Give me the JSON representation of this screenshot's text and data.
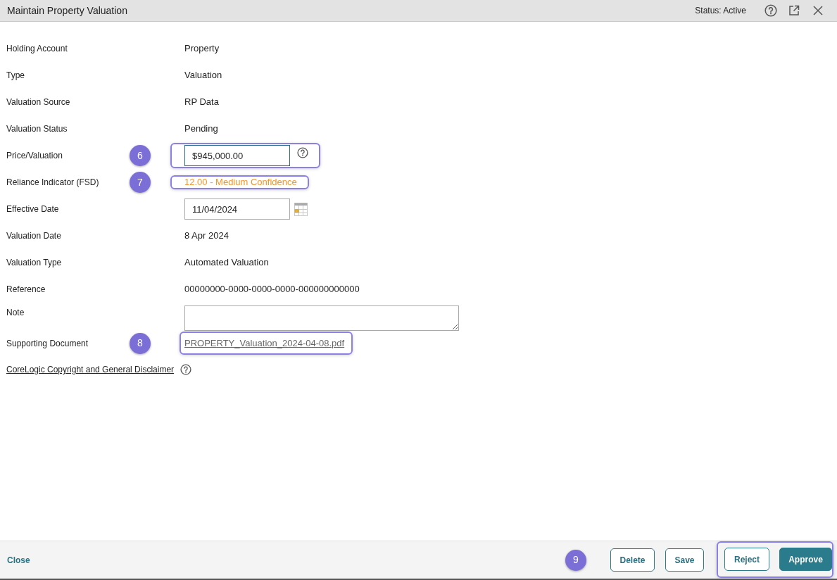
{
  "window": {
    "title": "Maintain Property Valuation",
    "status": "Status: Active"
  },
  "fields": [
    {
      "label": "Holding Account",
      "kind": "text",
      "value": "Property",
      "highlighted": false
    },
    {
      "label": "Type",
      "kind": "text",
      "value": "Valuation",
      "highlighted": false
    },
    {
      "label": "Valuation Source",
      "kind": "text",
      "value": "RP Data",
      "highlighted": false
    },
    {
      "label": "Valuation Status",
      "kind": "text",
      "value": "Pending",
      "highlighted": false
    },
    {
      "label": "Price/Valuation",
      "kind": "input",
      "value": "$945,000.00",
      "focused": true,
      "help": true,
      "callout": "6",
      "highlighted": true
    },
    {
      "label": "Reliance Indicator (FSD)",
      "kind": "rating",
      "value": "12.00 - Medium Confidence",
      "callout": "7",
      "highlighted": true
    },
    {
      "label": "Effective Date",
      "kind": "date",
      "value": "11/04/2024",
      "focused": false,
      "highlighted": false
    },
    {
      "label": "Valuation Date",
      "kind": "text",
      "value": "8 Apr 2024",
      "highlighted": false
    },
    {
      "label": "Valuation Type",
      "kind": "text",
      "value": "Automated Valuation",
      "highlighted": false
    },
    {
      "label": "Reference",
      "kind": "text",
      "value": "00000000-0000-0000-0000-000000000000",
      "highlighted": false
    },
    {
      "label": "Note",
      "kind": "textarea",
      "highlighted": false
    },
    {
      "label": "Supporting Document",
      "kind": "link",
      "value": "PROPERTY_Valuation_2024-04-08.pdf",
      "callout": "8",
      "highlighted": true
    }
  ],
  "disclaimer": {
    "link": "CoreLogic Copyright and General Disclaimer",
    "help": true
  },
  "footer": {
    "close": "Close",
    "callout": "9",
    "buttons": [
      {
        "label": "Delete",
        "kind": "outline",
        "highlighted": false
      },
      {
        "label": "Save",
        "kind": "outline",
        "highlighted": false
      },
      {
        "label": "Reject",
        "kind": "outline",
        "highlighted": true
      },
      {
        "label": "Approve",
        "kind": "primary",
        "highlighted": true
      }
    ]
  }
}
